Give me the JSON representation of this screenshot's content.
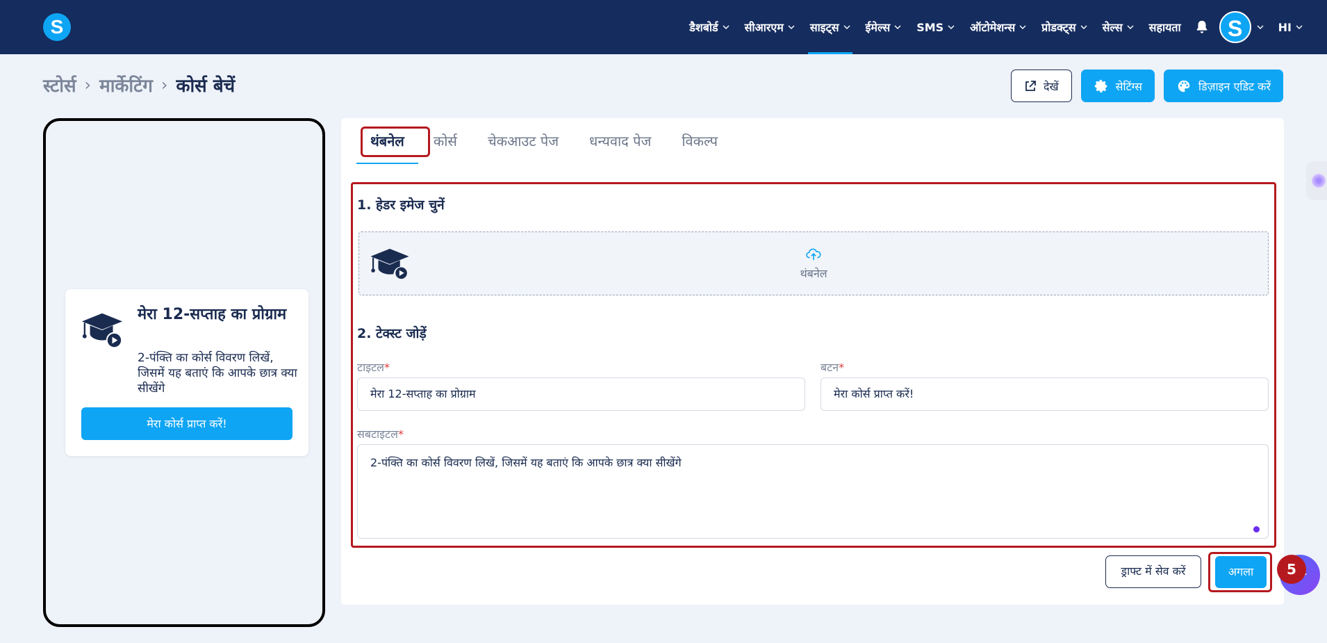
{
  "nav": {
    "items": [
      {
        "label": "डैशबोर्ड",
        "dropdown": true,
        "active": false
      },
      {
        "label": "सीआरएम",
        "dropdown": true,
        "active": false
      },
      {
        "label": "साइट्स",
        "dropdown": true,
        "active": true
      },
      {
        "label": "ईमेल्स",
        "dropdown": true,
        "active": false
      },
      {
        "label": "SMS",
        "dropdown": true,
        "active": false
      },
      {
        "label": "ऑटोमेशन्स",
        "dropdown": true,
        "active": false
      },
      {
        "label": "प्रोडक्ट्स",
        "dropdown": true,
        "active": false
      },
      {
        "label": "सेल्स",
        "dropdown": true,
        "active": false
      },
      {
        "label": "सहायता",
        "dropdown": false,
        "active": false
      }
    ],
    "logo_letter": "S",
    "avatar_letter": "S",
    "user_label": "HI",
    "bell_icon": "bell-icon"
  },
  "breadcrumb": {
    "items": [
      "स्टोर्स",
      "मार्केटिंग",
      "कोर्स बेचें"
    ]
  },
  "actions": {
    "view_label": "देखें",
    "settings_label": "सेटिंग्स",
    "design_label": "डिज़ाइन एडिट करें"
  },
  "preview": {
    "title": "मेरा 12-सप्ताह का प्रोग्राम",
    "subtitle": "2-पंक्ति का कोर्स विवरण लिखें, जिसमें यह बताएं कि आपके छात्र क्या सीखेंगे",
    "button": "मेरा कोर्स प्राप्त करें!"
  },
  "tabs": [
    {
      "label": "थंबनेल",
      "active": true
    },
    {
      "label": "कोर्स",
      "active": false
    },
    {
      "label": "चेकआउट पेज",
      "active": false
    },
    {
      "label": "धन्यवाद पेज",
      "active": false
    },
    {
      "label": "विकल्प",
      "active": false
    }
  ],
  "form": {
    "section1_title": "1. हेडर इमेज चुनें",
    "upload_label": "थंबनेल",
    "section2_title": "2. टेक्स्ट जोड़ें",
    "title_label": "टाइटल",
    "title_value": "मेरा 12-सप्ताह का प्रोग्राम",
    "button_label": "बटन",
    "button_value": "मेरा कोर्स प्राप्त करें!",
    "subtitle_label": "सबटाइटल",
    "subtitle_value": "2-पंक्ति का कोर्स विवरण लिखें, जिसमें यह बताएं कि आपके छात्र क्या सीखेंगे",
    "required_mark": "*"
  },
  "footer": {
    "draft_label": "ड्राफ्ट में सेव करें",
    "next_label": "अगला"
  },
  "step_badge": "5",
  "colors": {
    "nav_bg": "#152c5e",
    "accent": "#0ea5f4",
    "highlight": "#b5191f"
  }
}
